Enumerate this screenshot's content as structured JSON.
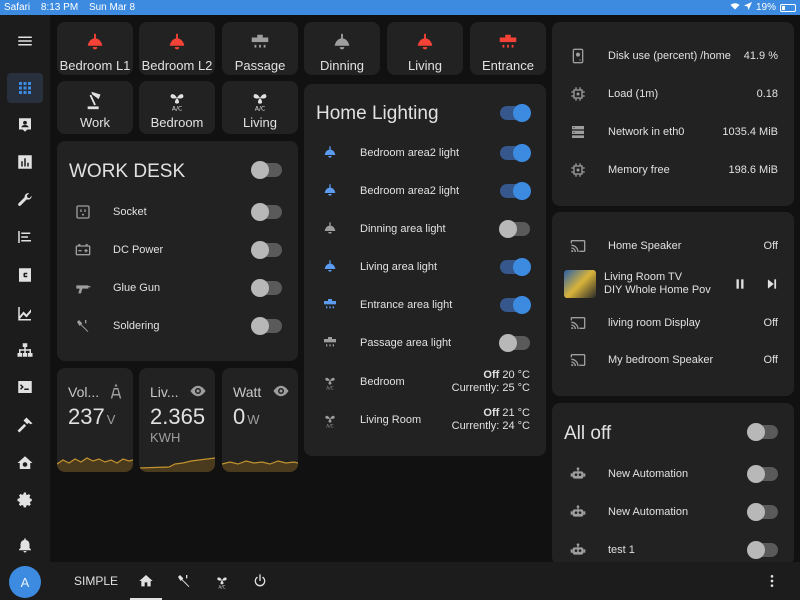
{
  "statusbar": {
    "app": "Safari",
    "time": "8:13 PM",
    "date": "Sun Mar 8",
    "battery": "19%"
  },
  "sidebar": {
    "items": [
      "menu-icon",
      "grid-icon",
      "badge-icon",
      "chart-icon",
      "wrench-icon",
      "list-icon",
      "c-box-icon",
      "trend-icon",
      "hierarchy-icon",
      "terminal-icon",
      "hammer-icon",
      "home-gear-icon",
      "settings-icon",
      "bell-icon"
    ],
    "avatar": "A"
  },
  "tiles_row1": [
    {
      "label": "Bedroom L1",
      "icon": "ceiling-light-icon",
      "color": "#f44336"
    },
    {
      "label": "Bedroom L2",
      "icon": "ceiling-light-icon",
      "color": "#f44336"
    },
    {
      "label": "Passage",
      "icon": "wall-light-icon",
      "color": "#9e9e9e"
    },
    {
      "label": "Dinning",
      "icon": "ceiling-light-icon",
      "color": "#9e9e9e"
    },
    {
      "label": "Living",
      "icon": "ceiling-light-icon",
      "color": "#f44336"
    },
    {
      "label": "Entrance",
      "icon": "wall-light-icon",
      "color": "#f44336"
    }
  ],
  "tiles_row2": [
    {
      "label": "Work",
      "icon": "desk-lamp-icon"
    },
    {
      "label": "Bedroom",
      "icon": "air-conditioner-icon"
    },
    {
      "label": "Living",
      "icon": "air-conditioner-icon"
    }
  ],
  "work_desk": {
    "title": "WORK DESK",
    "rows": [
      {
        "name": "Socket",
        "icon": "socket-icon",
        "on": false
      },
      {
        "name": "DC Power",
        "icon": "battery-icon",
        "on": false
      },
      {
        "name": "Glue Gun",
        "icon": "glue-gun-icon",
        "on": false
      },
      {
        "name": "Soldering",
        "icon": "soldering-icon",
        "on": false
      }
    ]
  },
  "sensors": [
    {
      "name": "Vol...",
      "value": "237",
      "unit": "V",
      "icon": "tower-icon"
    },
    {
      "name": "Liv...",
      "value": "2.365",
      "unit": "KWH",
      "icon": "eye-icon"
    },
    {
      "name": "Watt",
      "value": "0",
      "unit": "W",
      "icon": "eye-icon"
    }
  ],
  "home_lighting": {
    "title": "Home Lighting",
    "master_on": true,
    "rows": [
      {
        "name": "Bedroom area2 light",
        "icon": "ceiling-light-icon",
        "on": true,
        "color": "#5b9bf0"
      },
      {
        "name": "Bedroom area2 light",
        "icon": "ceiling-light-icon",
        "on": true,
        "color": "#5b9bf0"
      },
      {
        "name": "Dinning area light",
        "icon": "ceiling-light-icon",
        "on": false,
        "color": "#9e9e9e"
      },
      {
        "name": "Living area light",
        "icon": "ceiling-light-icon",
        "on": true,
        "color": "#5b9bf0"
      },
      {
        "name": "Entrance area light",
        "icon": "wall-light-icon",
        "on": true,
        "color": "#5b9bf0"
      },
      {
        "name": "Passage area light",
        "icon": "wall-light-icon",
        "on": false,
        "color": "#9e9e9e"
      }
    ],
    "climate": [
      {
        "name": "Bedroom",
        "state": "Off",
        "target": "20 °C",
        "current": "Currently: 25 °C"
      },
      {
        "name": "Living Room",
        "state": "Off",
        "target": "21 °C",
        "current": "Currently: 24 °C"
      }
    ]
  },
  "system": [
    {
      "name": "Disk use (percent) /home",
      "value": "41.9 %",
      "icon": "harddisk-icon"
    },
    {
      "name": "Load (1m)",
      "value": "0.18",
      "icon": "chip-icon"
    },
    {
      "name": "Network in eth0",
      "value": "1035.4 MiB",
      "icon": "server-icon"
    },
    {
      "name": "Memory free",
      "value": "198.6 MiB",
      "icon": "chip-icon"
    }
  ],
  "media": {
    "rows": [
      {
        "name": "Home Speaker",
        "state": "Off"
      },
      {
        "name": "living room Display",
        "state": "Off"
      },
      {
        "name": "My bedroom Speaker",
        "state": "Off"
      }
    ],
    "playing": {
      "name": "Living Room TV",
      "title": "DIY Whole Home Pov"
    }
  },
  "automations": {
    "title": "All off",
    "rows": [
      {
        "name": "New Automation",
        "on": false
      },
      {
        "name": "New Automation",
        "on": false
      },
      {
        "name": "test 1",
        "on": false
      }
    ]
  },
  "bottombar": {
    "label": "SIMPLE"
  }
}
